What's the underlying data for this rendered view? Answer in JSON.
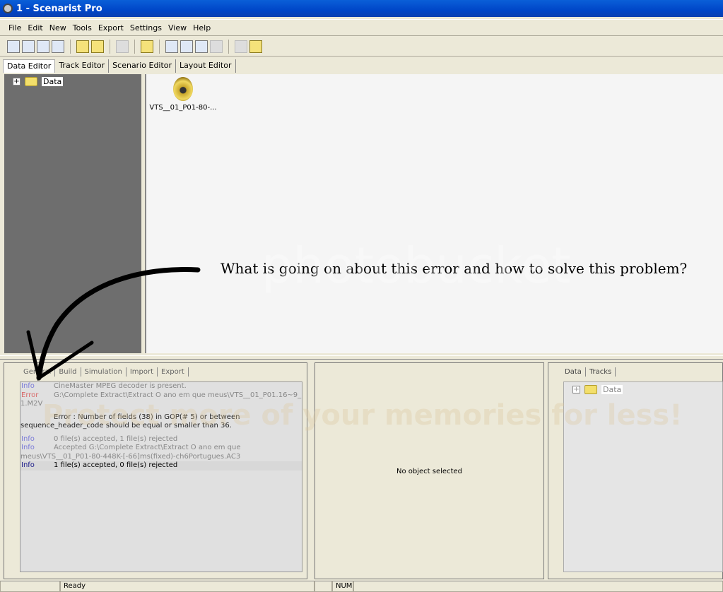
{
  "window": {
    "title": "1 - Scenarist Pro"
  },
  "menu": [
    "File",
    "Edit",
    "New",
    "Tools",
    "Export",
    "Settings",
    "View",
    "Help"
  ],
  "editor_tabs": [
    "Data Editor",
    "Track Editor",
    "Scenario Editor",
    "Layout Editor"
  ],
  "tree": {
    "root": "Data"
  },
  "main": {
    "file_name": "VTS__01_P01-80-..."
  },
  "annotation": "What is going on about this error and how to solve this problem?",
  "log_tabs": [
    "General",
    "Build",
    "Simulation",
    "Import",
    "Export"
  ],
  "log": [
    {
      "type": "Info",
      "text": "CineMaster MPEG decoder is present."
    },
    {
      "type": "Error",
      "text": "G:\\Complete Extract\\Extract O ano em que meus\\VTS__01_P01.16~9_ 1.M2V"
    },
    {
      "type": "",
      "text": "Error : Number of fields (38) in GOP(# 5) or between sequence_header_code should be equal or smaller than 36."
    },
    {
      "type": "Info",
      "text": "0 file(s) accepted, 1 file(s) rejected"
    },
    {
      "type": "Info",
      "text": "Accepted G:\\Complete Extract\\Extract O ano em que meus\\VTS__01_P01-80-448K-[-66]ms(fixed)-ch6Portugues.AC3"
    },
    {
      "type": "Info",
      "text": "1 file(s) accepted, 0 file(s) rejected"
    }
  ],
  "properties": {
    "empty_text": "No object selected"
  },
  "right_tabs": [
    "Data",
    "Tracks"
  ],
  "right_tree": {
    "root": "Data"
  },
  "status": {
    "text": "Ready",
    "num": "NUM"
  },
  "watermark": {
    "brand": "photobucket",
    "slogan": "Protect more of your memories for less!"
  }
}
